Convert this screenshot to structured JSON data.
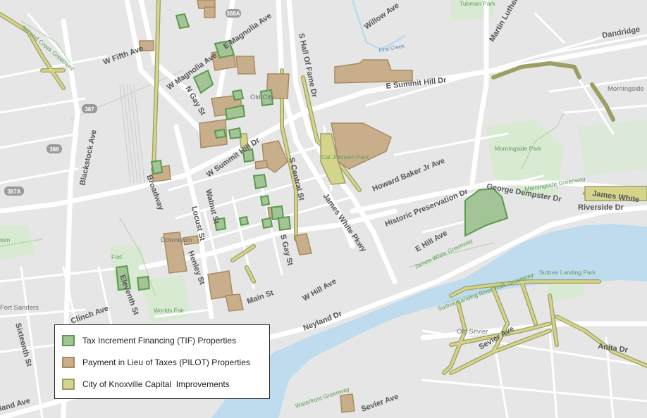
{
  "legend": {
    "items": [
      {
        "label": "Tax Increment Financing (TIF) Properties",
        "fill": "#a3c496",
        "stroke": "#5a9a4c"
      },
      {
        "label": "Payment in Lieu of Taxes (PILOT) Properties",
        "fill": "#c8ae8a",
        "stroke": "#a68b63"
      },
      {
        "label": "City of Knoxville Capital  Improvements",
        "fill": "#d4d58a",
        "stroke": "#9d9d66"
      }
    ]
  },
  "colors": {
    "land": "#e6e6e6",
    "road": "#ffffff",
    "water": "#bfdcef",
    "park": "#d8ead2"
  },
  "streets": {
    "w_fifth": "W Fifth Ave",
    "w_magnolia": "W Magnolia Ave",
    "e_magnolia": "E Magnolia Ave",
    "willow": "Willow Ave",
    "martin_luther": "Martin Luther",
    "dandridge": "Dandridge",
    "hall_of_fame": "S Hall Of Fame Dr",
    "e_summit_hill": "E Summit Hill Dr",
    "n_gay": "N Gay St",
    "blackstock": "Blackstock Ave",
    "w_summit_hill": "W Summit Hill Dr",
    "s_central": "S Central St",
    "howard_baker": "Howard Baker Jr Ave",
    "broadway": "Broadway",
    "walnut": "Walnut St",
    "locust": "Locust St",
    "james_white": "James White Pkwy",
    "historic_preservation": "Historic Preservation Dr",
    "george_dempster": "George Dempster Dr",
    "riverside": "Riverside Dr",
    "james_white_2": "James White",
    "e_hill": "E Hill Ave",
    "s_gay": "S Gay St",
    "henley": "Henley St",
    "eleventh": "Eleventh St",
    "main": "Main St",
    "w_hill": "W Hill Ave",
    "clinch": "Clinch Ave",
    "sixteenth": "Sixteenth St",
    "neyland": "Neyland Dr",
    "sevier_ave_1": "Sevier Ave",
    "sevier_ave_2": "Sevier Ave",
    "anita": "Anita Dr",
    "cumberland": "land Ave"
  },
  "areas": {
    "downtown": "Downtown",
    "fort_sanders": "Fort Sanders",
    "old_sevier": "Old Sevier",
    "morningside": "Morningside",
    "old_city": "Old City"
  },
  "parks": {
    "tubman": "Tubman Park",
    "morningside_park": "Morningside Park",
    "cal_johnson": "Cal Johnson Park",
    "fort_park": "Fort",
    "worlds_fair": "Worlds Fair",
    "suttree": "Suttree Landing Park",
    "tom": "tom"
  },
  "greenways": {
    "morningside_gw": "Morningside Greenway",
    "james_white_gw": "James White Greenway",
    "suttree_gw": "Suttree Landing River Walk Greenway",
    "waterfront_gw": "Waterfront Greenway",
    "second_creek": "Second Creek Greenway",
    "first_creek": "First Creek"
  },
  "shields": {
    "s388a": "388A",
    "s387": "387",
    "s388": "388",
    "s387a": "387A"
  }
}
